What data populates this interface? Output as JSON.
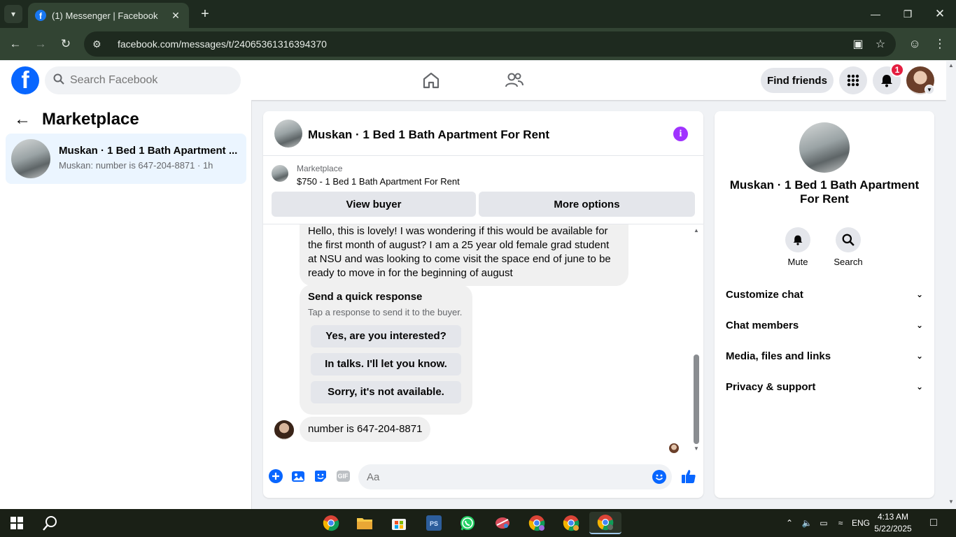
{
  "browser": {
    "tab_title": "(1) Messenger | Facebook",
    "url": "facebook.com/messages/t/24065361316394370"
  },
  "fb": {
    "search_placeholder": "Search Facebook",
    "find_friends": "Find friends",
    "notification_count": "1",
    "brand_color": "#0866ff"
  },
  "left_pane": {
    "back_label": "←",
    "title": "Marketplace",
    "conversations": [
      {
        "name": "Muskan · 1 Bed 1 Bath Apartment ...",
        "snippet": "Muskan: number is 647-204-8871 · 1h"
      }
    ]
  },
  "chat": {
    "header_title": "Muskan · 1 Bed 1 Bath Apartment For Rent",
    "marketplace_label": "Marketplace",
    "listing": "$750 - 1 Bed 1 Bath Apartment For Rent",
    "view_buyer": "View buyer",
    "more_options": "More options",
    "messages": [
      {
        "text": "Hello, this is lovely! I was wondering if this would be available for the first month of august? I am a 25 year old female grad student at NSU and was looking to come visit the space end of june to be ready to move in for the beginning of august"
      },
      {
        "text": "number is 647-204-8871"
      }
    ],
    "quick_response": {
      "title": "Send a quick response",
      "subtitle": "Tap a response to send it to the buyer.",
      "options": [
        "Yes, are you interested?",
        "In talks. I'll let you know.",
        "Sorry, it's not available."
      ]
    },
    "composer_placeholder": "Aa",
    "gif_label": "GIF"
  },
  "right_pane": {
    "name": "Muskan · 1 Bed 1 Bath Apartment For Rent",
    "actions": [
      "Mute",
      "Search"
    ],
    "sections": [
      "Customize chat",
      "Chat members",
      "Media, files and links",
      "Privacy & support"
    ]
  },
  "taskbar": {
    "time": "4:13 AM",
    "date": "5/22/2025",
    "lang": "ENG"
  }
}
